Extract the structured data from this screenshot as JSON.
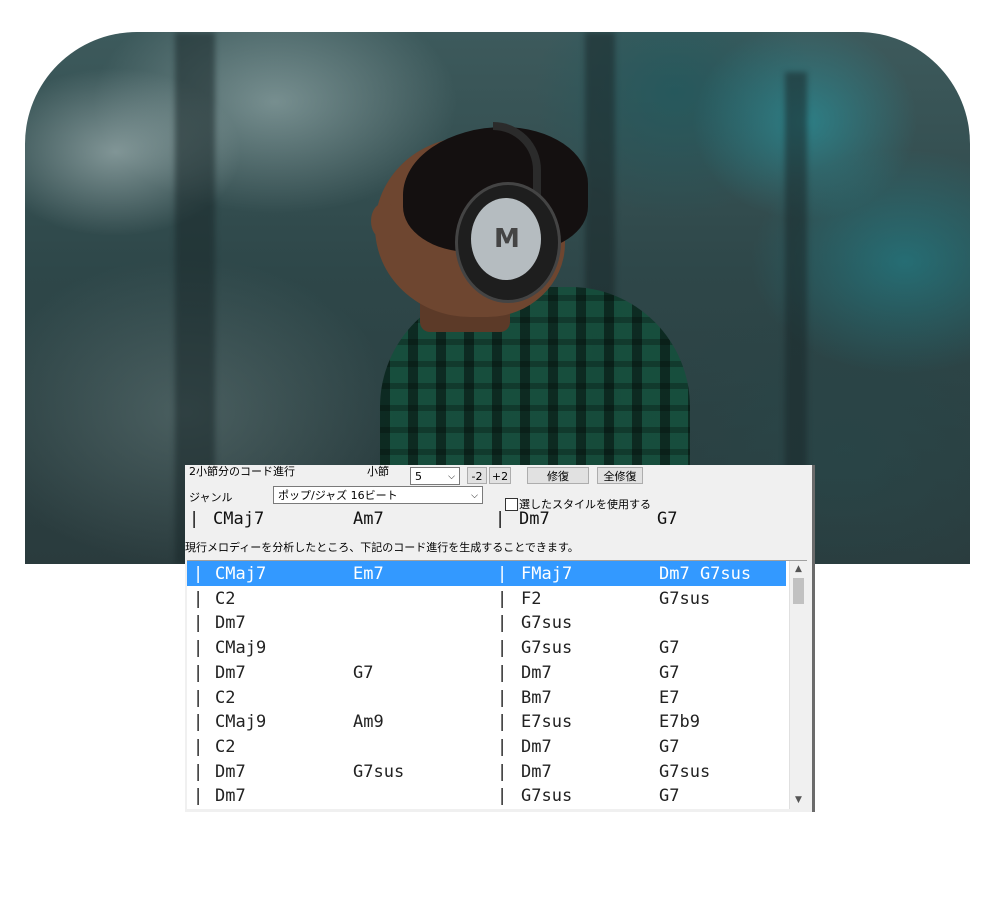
{
  "dialog": {
    "progression_label": "2小節分のコード進行",
    "bar_label": "小節",
    "bar_value": "5",
    "minus2": "-2",
    "plus2": "+2",
    "repair": "修復",
    "repair_all": "全修復",
    "genre_label": "ジャンル",
    "genre_value": "ポップ/ジャズ 16ビート",
    "use_style_label": "選したスタイルを使用する",
    "current": [
      "|",
      "CMaj7",
      "Am7",
      "|",
      "Dm7",
      "G7"
    ],
    "analysis_msg": "現行メロディーを分析したところ、下記のコード進行を生成することできます。",
    "rows": [
      [
        "|",
        "CMaj7",
        "Em7",
        "|",
        "FMaj7",
        "Dm7 G7sus"
      ],
      [
        "|",
        "C2",
        "",
        "|",
        "F2",
        "G7sus"
      ],
      [
        "|",
        "Dm7",
        "",
        "|",
        "G7sus",
        ""
      ],
      [
        "|",
        "CMaj9",
        "",
        "|",
        "G7sus",
        "G7"
      ],
      [
        "|",
        "Dm7",
        "G7",
        "|",
        "Dm7",
        "G7"
      ],
      [
        "|",
        "C2",
        "",
        "|",
        "Bm7",
        "E7"
      ],
      [
        "|",
        "CMaj9",
        "Am9",
        "|",
        "E7sus",
        "E7b9"
      ],
      [
        "|",
        "C2",
        "",
        "|",
        "Dm7",
        "G7"
      ],
      [
        "|",
        "Dm7",
        "G7sus",
        "|",
        "Dm7",
        "G7sus"
      ],
      [
        "|",
        "Dm7",
        "",
        "|",
        "G7sus",
        "G7"
      ]
    ],
    "selected_row": 0
  },
  "icons": {
    "scroll_up": "scroll-up-icon",
    "scroll_down": "scroll-down-icon",
    "dropdown": "chevron-down-icon"
  },
  "colors": {
    "selection": "#3399ff",
    "dialog_bg": "#f0f0f0"
  }
}
